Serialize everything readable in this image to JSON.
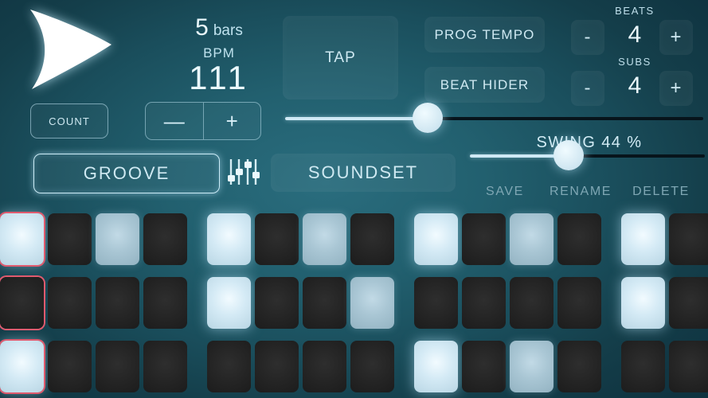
{
  "theme": {
    "bg_center": "#2a6d7e",
    "bg_edge": "#0f3340",
    "text": "#d7eef5",
    "accent": "#cfe9f5",
    "cursor_outline": "#e05a6e",
    "pad_on": "#e9f6fc",
    "pad_mid": "#a9c6d4",
    "pad_off": "#242424"
  },
  "transport": {
    "play_icon": "play-arrow-icon",
    "count_label": "COUNT"
  },
  "tempo": {
    "bars_value": "5",
    "bars_unit": "bars",
    "bpm_label": "BPM",
    "bpm_value": "111",
    "minus_label": "—",
    "plus_label": "+",
    "tap_label": "TAP",
    "slider_percent": 34
  },
  "options": {
    "prog_tempo_label": "PROG TEMPO",
    "beat_hider_label": "BEAT HIDER"
  },
  "meter": {
    "beats_label": "BEATS",
    "beats_value": "4",
    "subs_label": "SUBS",
    "subs_value": "4",
    "minus_label": "-",
    "plus_label": "+"
  },
  "swing": {
    "label": "SWING",
    "value": "44",
    "unit": "%",
    "slider_percent": 42
  },
  "presets": {
    "groove_label": "GROOVE",
    "mixer_icon": "mixer-faders-icon",
    "soundset_label": "SOUNDSET",
    "save_label": "SAVE",
    "rename_label": "RENAME",
    "delete_label": "DELETE"
  },
  "grid": {
    "columns": 16,
    "group_size": 4,
    "cursor_column": 1,
    "rows": [
      {
        "name": "row-1",
        "states": [
          "on",
          "off",
          "mid",
          "off",
          "on",
          "off",
          "mid",
          "off",
          "on",
          "off",
          "mid",
          "off",
          "on",
          "off",
          "mid",
          "off"
        ]
      },
      {
        "name": "row-2",
        "states": [
          "off",
          "off",
          "off",
          "off",
          "on",
          "off",
          "off",
          "mid",
          "off",
          "off",
          "off",
          "off",
          "on",
          "off",
          "off",
          "mid"
        ]
      },
      {
        "name": "row-3",
        "states": [
          "on",
          "off",
          "off",
          "off",
          "off",
          "off",
          "off",
          "off",
          "on",
          "off",
          "mid",
          "off",
          "off",
          "off",
          "off",
          "off"
        ]
      }
    ]
  }
}
